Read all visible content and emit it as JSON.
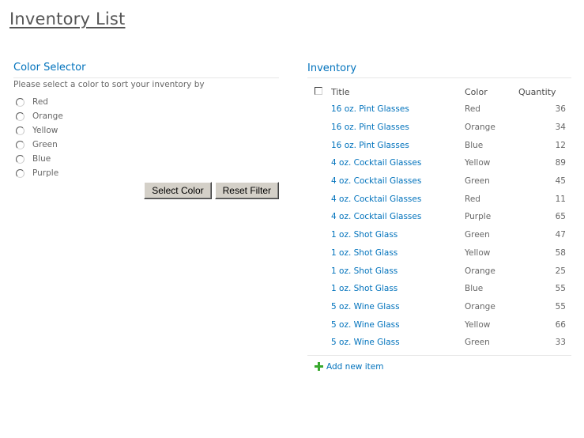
{
  "page": {
    "title": "Inventory List"
  },
  "color_selector": {
    "title": "Color Selector",
    "description": "Please select a color to sort your inventory by",
    "options": [
      "Red",
      "Orange",
      "Yellow",
      "Green",
      "Blue",
      "Purple"
    ],
    "selected": null,
    "select_button_label": "Select Color",
    "reset_button_label": "Reset Filter"
  },
  "inventory": {
    "title": "Inventory",
    "columns": {
      "title": "Title",
      "color": "Color",
      "quantity": "Quantity"
    },
    "rows": [
      {
        "title": "16 oz. Pint Glasses",
        "color": "Red",
        "quantity": "36"
      },
      {
        "title": "16 oz. Pint Glasses",
        "color": "Orange",
        "quantity": "34"
      },
      {
        "title": "16 oz. Pint Glasses",
        "color": "Blue",
        "quantity": "12"
      },
      {
        "title": "4 oz. Cocktail Glasses",
        "color": "Yellow",
        "quantity": "89"
      },
      {
        "title": "4 oz. Cocktail Glasses",
        "color": "Green",
        "quantity": "45"
      },
      {
        "title": "4 oz. Cocktail Glasses",
        "color": "Red",
        "quantity": "11"
      },
      {
        "title": "4 oz. Cocktail Glasses",
        "color": "Purple",
        "quantity": "65"
      },
      {
        "title": "1 oz. Shot Glass",
        "color": "Green",
        "quantity": "47"
      },
      {
        "title": "1 oz. Shot Glass",
        "color": "Yellow",
        "quantity": "58"
      },
      {
        "title": "1 oz. Shot Glass",
        "color": "Orange",
        "quantity": "25"
      },
      {
        "title": "1 oz. Shot Glass",
        "color": "Blue",
        "quantity": "55"
      },
      {
        "title": "5 oz. Wine Glass",
        "color": "Orange",
        "quantity": "55"
      },
      {
        "title": "5 oz. Wine Glass",
        "color": "Yellow",
        "quantity": "66"
      },
      {
        "title": "5 oz. Wine Glass",
        "color": "Green",
        "quantity": "33"
      }
    ],
    "add_new_item_label": "Add new item",
    "add_icon": "plus-icon"
  },
  "colors": {
    "link": "#0072bc",
    "text": "#676767",
    "add_icon": "#38a82e",
    "button_face": "#d4d0c8"
  }
}
